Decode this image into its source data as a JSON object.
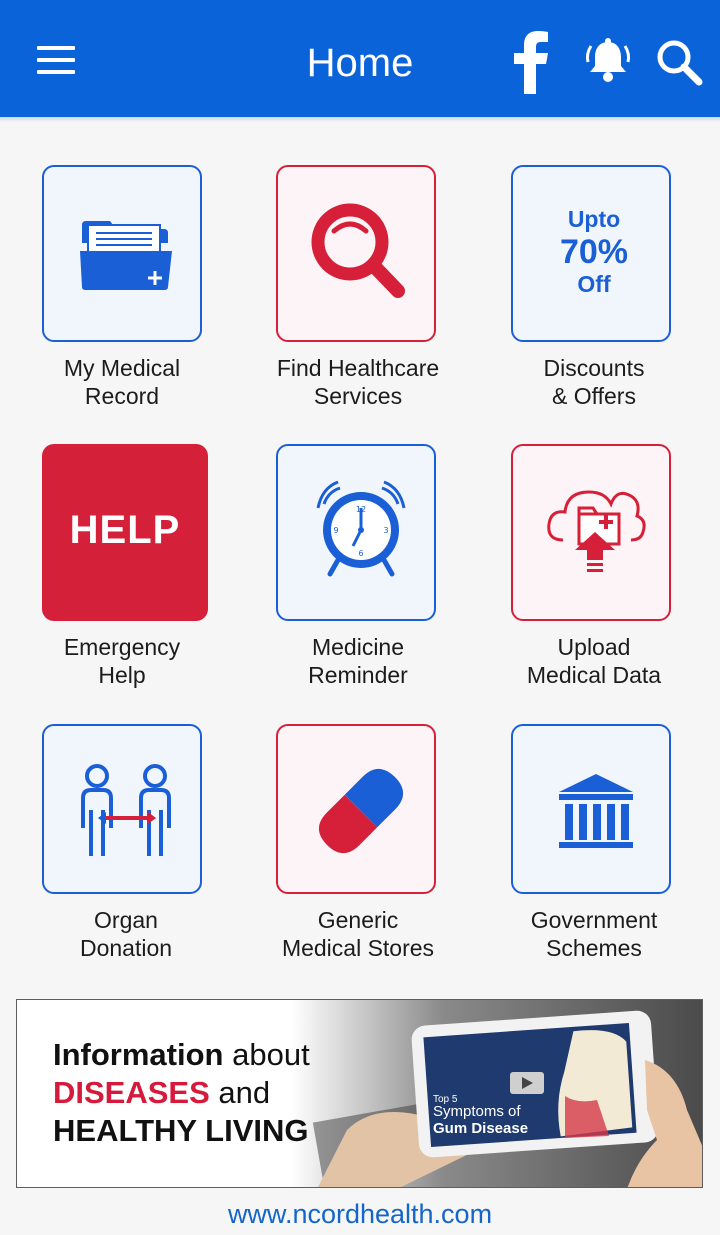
{
  "header": {
    "title": "Home",
    "menu_icon": "hamburger-menu-icon",
    "facebook_icon": "facebook-icon",
    "notification_icon": "bell-icon",
    "search_icon": "search-icon",
    "background_color": "#0a63d8"
  },
  "tiles": [
    {
      "line1": "My Medical",
      "line2": "Record",
      "icon": "medical-folder-icon"
    },
    {
      "line1": "Find Healthcare",
      "line2": "Services",
      "icon": "magnifier-icon"
    },
    {
      "line1": "Discounts",
      "line2": "& Offers",
      "icon": "discount-badge-icon",
      "badge": {
        "top": "Upto",
        "middle": "70%",
        "bottom": "Off"
      }
    },
    {
      "line1": "Emergency",
      "line2": "Help",
      "icon": "help-icon",
      "badge_text": "HELP"
    },
    {
      "line1": "Medicine",
      "line2": "Reminder",
      "icon": "alarm-clock-icon"
    },
    {
      "line1": "Upload",
      "line2": "Medical Data",
      "icon": "cloud-upload-icon"
    },
    {
      "line1": "Organ",
      "line2": "Donation",
      "icon": "organ-donation-icon"
    },
    {
      "line1": "Generic",
      "line2": "Medical Stores",
      "icon": "pill-capsule-icon"
    },
    {
      "line1": "Government",
      "line2": "Schemes",
      "icon": "government-building-icon"
    }
  ],
  "banner": {
    "line1_bold": "Information",
    "line1_rest": " about",
    "line2_red": "DISEASES",
    "line2_rest": " and",
    "line3": "HEALTHY LIVING",
    "video_small": "Top 5",
    "video_line1": "Symptoms of",
    "video_line2": "Gum Disease"
  },
  "footer": {
    "link": "www.ncordhealth.com"
  },
  "colors": {
    "blue": "#1a5fd6",
    "red": "#d61f38",
    "link": "#1466c9"
  }
}
